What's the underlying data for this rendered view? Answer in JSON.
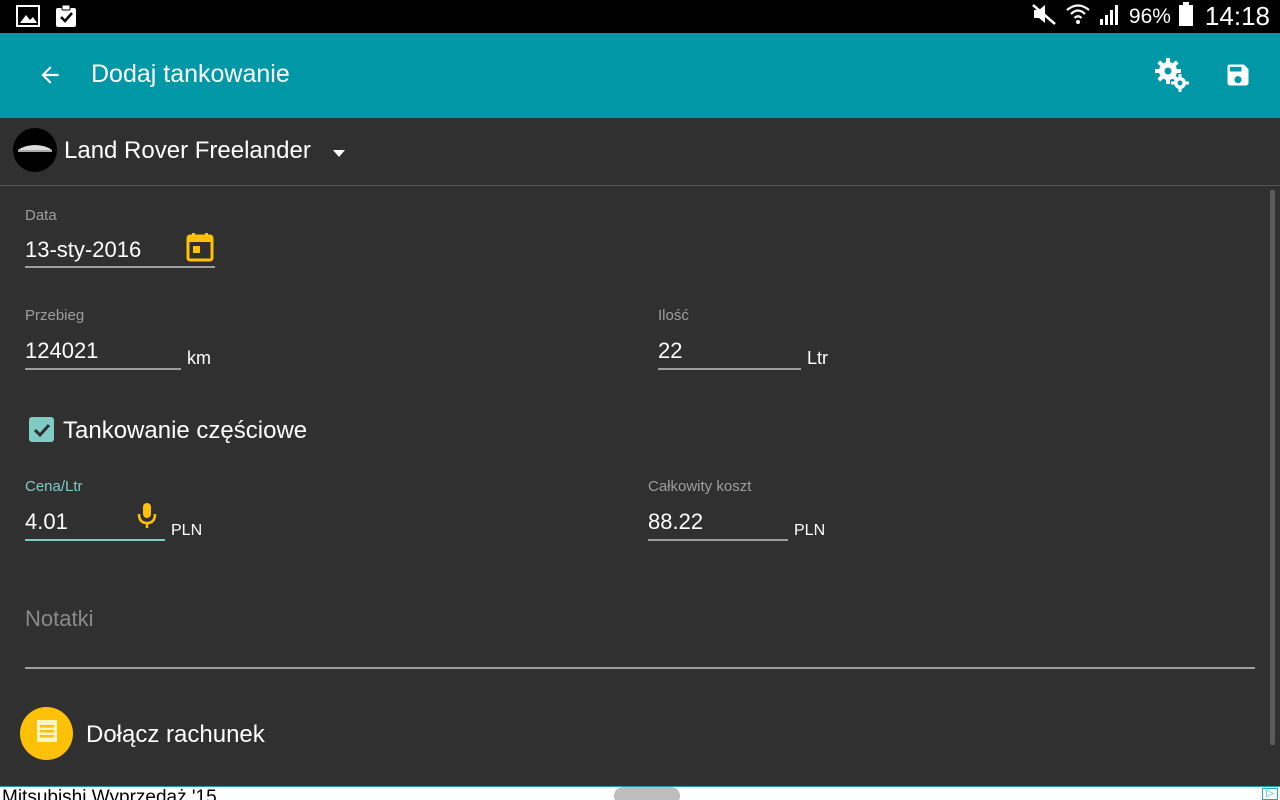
{
  "status_bar": {
    "battery": "96%",
    "time": "14:18",
    "icons": [
      "gallery-icon",
      "clipboard-check-icon",
      "mute-icon",
      "wifi-icon",
      "signal-icon",
      "battery-icon"
    ]
  },
  "toolbar": {
    "title": "Dodaj tankowanie",
    "back_icon": "arrow-left-icon",
    "settings_icon": "settings-icon",
    "save_icon": "save-icon",
    "color": "#0097a7"
  },
  "vehicle": {
    "name": "Land Rover Freelander"
  },
  "form": {
    "date": {
      "label": "Data",
      "value": "13-sty-2016"
    },
    "mileage": {
      "label": "Przebieg",
      "value": "124021",
      "unit": "km"
    },
    "quantity": {
      "label": "Ilość",
      "value": "22",
      "unit": "Ltr"
    },
    "partial_fill": {
      "label": "Tankowanie częściowe",
      "checked": true
    },
    "price": {
      "label": "Cena/Ltr",
      "value": "4.01",
      "unit": "PLN"
    },
    "total": {
      "label": "Całkowity koszt",
      "value": "88.22",
      "unit": "PLN"
    },
    "notes": {
      "placeholder": "Notatki"
    },
    "attach": {
      "label": "Dołącz rachunek"
    }
  },
  "ad": {
    "text": "Mitsubishi Wyprzedaż '15"
  },
  "colors": {
    "accent": "#80cbc4",
    "amber": "#ffc107",
    "background": "#303030"
  }
}
